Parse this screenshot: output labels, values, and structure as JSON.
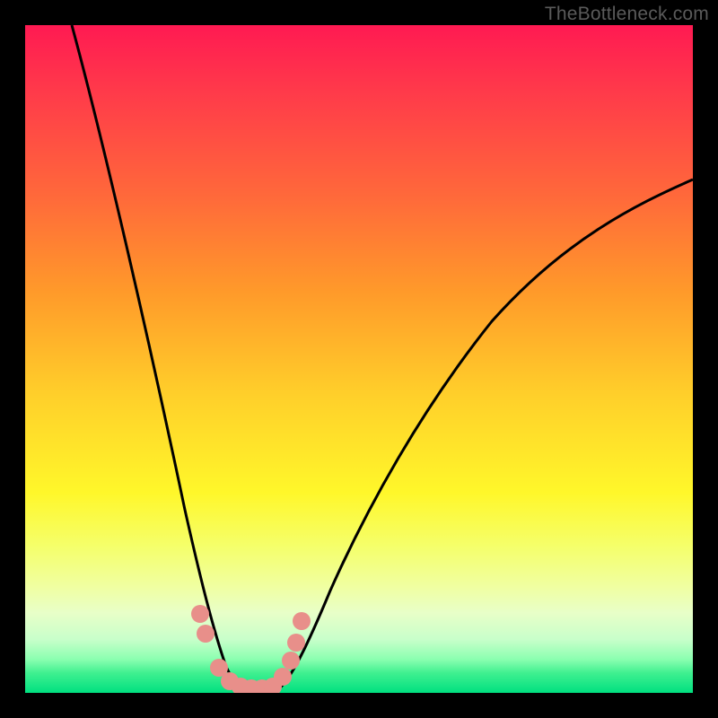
{
  "attribution": "TheBottleneck.com",
  "chart_data": {
    "type": "line",
    "title": "",
    "xlabel": "",
    "ylabel": "",
    "xlim": [
      0,
      100
    ],
    "ylim": [
      0,
      100
    ],
    "series": [
      {
        "name": "left-curve",
        "x": [
          7,
          10,
          13,
          16,
          19,
          21,
          23,
          25,
          26,
          27,
          28,
          29,
          30
        ],
        "y": [
          100,
          84,
          68,
          52,
          36,
          24,
          15,
          8,
          5,
          3,
          2,
          1,
          0
        ]
      },
      {
        "name": "right-curve",
        "x": [
          38,
          40,
          43,
          47,
          52,
          58,
          65,
          73,
          82,
          92,
          100
        ],
        "y": [
          0,
          3,
          8,
          15,
          24,
          34,
          44,
          54,
          63,
          71,
          77
        ]
      },
      {
        "name": "valley-floor",
        "x": [
          30,
          32,
          34,
          36,
          38
        ],
        "y": [
          0,
          0,
          0,
          0,
          0
        ]
      }
    ],
    "markers": {
      "name": "salmon-dots",
      "color": "#e88f8a",
      "points": [
        {
          "x": 25.5,
          "y": 11
        },
        {
          "x": 26.5,
          "y": 8
        },
        {
          "x": 28.5,
          "y": 3
        },
        {
          "x": 30.0,
          "y": 1.2
        },
        {
          "x": 31.5,
          "y": 1.0
        },
        {
          "x": 33.0,
          "y": 1.0
        },
        {
          "x": 34.5,
          "y": 1.0
        },
        {
          "x": 36.0,
          "y": 1.2
        },
        {
          "x": 37.5,
          "y": 2.5
        },
        {
          "x": 39.0,
          "y": 5
        },
        {
          "x": 40.0,
          "y": 8
        },
        {
          "x": 40.8,
          "y": 11
        }
      ]
    },
    "gradient_bands": [
      {
        "stop": 0,
        "color": "#ff1a52"
      },
      {
        "stop": 70,
        "color": "#fff72a"
      },
      {
        "stop": 100,
        "color": "#00e080"
      }
    ]
  }
}
